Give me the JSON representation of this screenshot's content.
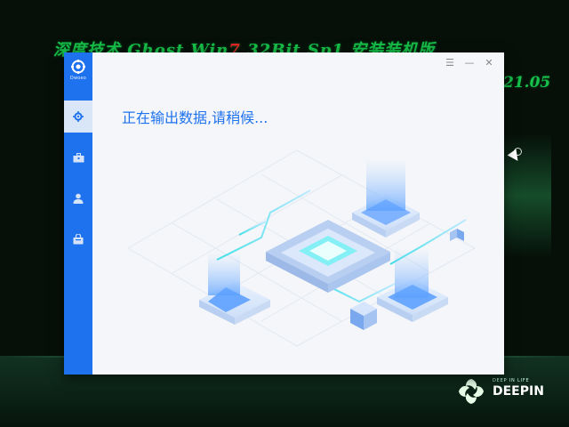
{
  "desktop": {
    "banner_part1": "深度技术 Ghost Win",
    "banner_seven": "7",
    "banner_part2": " 32Bit Sp1 安装装机版",
    "banner_right": "21.05",
    "brand_tagline": "DEEP IN LIFE",
    "brand_name": "DEEPIN"
  },
  "window": {
    "logo_label": "Dwoeo",
    "status_text": "正在输出数据,请稍候...",
    "controls": {
      "menu": "☰",
      "minimize": "—",
      "close": "✕"
    },
    "sidebar": [
      {
        "name": "settings",
        "icon": "gear-icon",
        "active": true
      },
      {
        "name": "toolbox",
        "icon": "toolbox-icon",
        "active": false
      },
      {
        "name": "user",
        "icon": "user-icon",
        "active": false
      },
      {
        "name": "bag",
        "icon": "bag-icon",
        "active": false
      }
    ]
  },
  "colors": {
    "accent": "#1f72ee",
    "banner_green": "#16c04a",
    "banner_red": "#e02525",
    "window_bg": "#f4f6f9"
  }
}
